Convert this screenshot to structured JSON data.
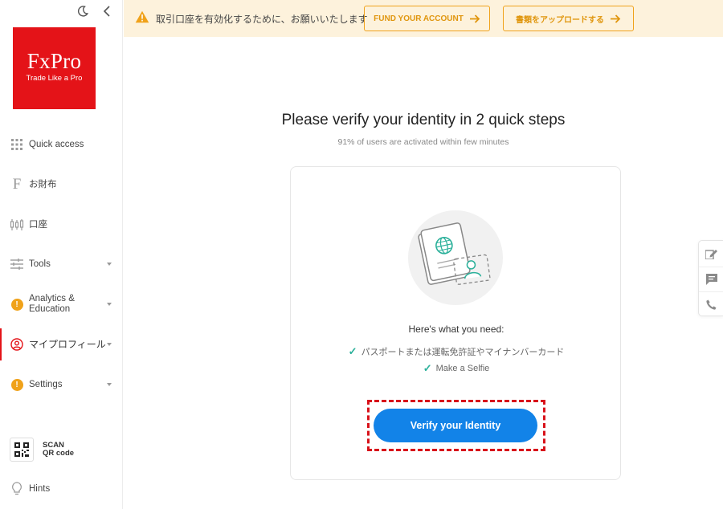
{
  "brand": {
    "name": "FxPro",
    "tagline": "Trade Like a Pro",
    "color": "#e41318"
  },
  "sidebar": {
    "items": [
      {
        "label": "Quick access",
        "icon": "grid-icon"
      },
      {
        "label": "お財布",
        "icon": "wallet-f-icon"
      },
      {
        "label": "口座",
        "icon": "candlestick-icon"
      },
      {
        "label": "Tools",
        "icon": "sliders-icon",
        "caret": true
      },
      {
        "label": "Analytics & Education",
        "label1": "Analytics &",
        "label2": "Education",
        "icon": "warning-icon",
        "caret": true
      },
      {
        "label": "マイプロフィール",
        "icon": "user-circle-icon",
        "caret": true,
        "active": true
      },
      {
        "label": "Settings",
        "icon": "warning-icon",
        "caret": true
      }
    ],
    "scan": {
      "line1": "SCAN",
      "line2": "QR code"
    },
    "hints": "Hints"
  },
  "banner": {
    "message": "取引口座を有効化するために、お願いいたします",
    "fund_button": "FUND YOUR ACCOUNT",
    "upload_button": "書類をアップロードする",
    "accent": "#f0a21a"
  },
  "main": {
    "title": "Please verify your identity in 2 quick steps",
    "subtitle": "91% of users are activated within few minutes",
    "need_label": "Here's what you need:",
    "requirements": [
      "パスポートまたは運転免許証やマイナンバーカード",
      "Make a Selfie"
    ],
    "verify_button": "Verify your Identity",
    "button_color": "#1283e8",
    "check_color": "#2ab09a"
  }
}
